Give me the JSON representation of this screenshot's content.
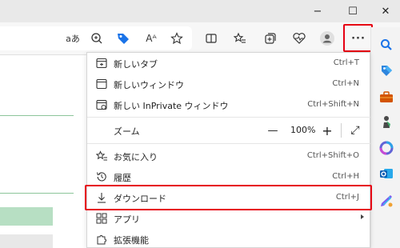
{
  "window": {
    "minimize_glyph": "−",
    "maximize_glyph": "☐",
    "close_glyph": "✕"
  },
  "toolbar": {
    "read_aloud_label": "aあ",
    "read_aloud_tooltip": "Aᴬ",
    "more_label": "···",
    "icons": [
      "translate-icon",
      "zoom-icon",
      "coupon-tag-icon",
      "read-aloud-icon",
      "favorite-star-icon",
      "split-screen-icon",
      "favorites-icon",
      "collections-icon",
      "health-icon",
      "profile-icon",
      "more-icon"
    ]
  },
  "menu": {
    "items": [
      {
        "label": "新しいタブ",
        "shortcut": "Ctrl+T",
        "icon": "new-tab-icon"
      },
      {
        "label": "新しいウィンドウ",
        "shortcut": "Ctrl+N",
        "icon": "new-window-icon"
      },
      {
        "label": "新しい InPrivate ウィンドウ",
        "shortcut": "Ctrl+Shift+N",
        "icon": "inprivate-icon"
      },
      {
        "label": "お気に入り",
        "shortcut": "Ctrl+Shift+O",
        "icon": "favorites-list-icon"
      },
      {
        "label": "履歴",
        "shortcut": "Ctrl+H",
        "icon": "history-icon"
      },
      {
        "label": "ダウンロード",
        "shortcut": "Ctrl+J",
        "icon": "download-icon"
      },
      {
        "label": "アプリ",
        "shortcut": "",
        "icon": "apps-icon"
      },
      {
        "label": "拡張機能",
        "shortcut": "",
        "icon": "extensions-icon"
      }
    ],
    "zoom": {
      "label": "ズーム",
      "minus": "—",
      "value": "100%",
      "plus": "+",
      "fullscreen_glyph": "⤢"
    }
  },
  "highlight_color": "#e60012",
  "sidebar": {
    "icons": [
      "search-icon",
      "shopping-tag-icon",
      "tools-icon",
      "games-icon",
      "microsoft365-icon",
      "outlook-icon",
      "designer-icon"
    ]
  }
}
